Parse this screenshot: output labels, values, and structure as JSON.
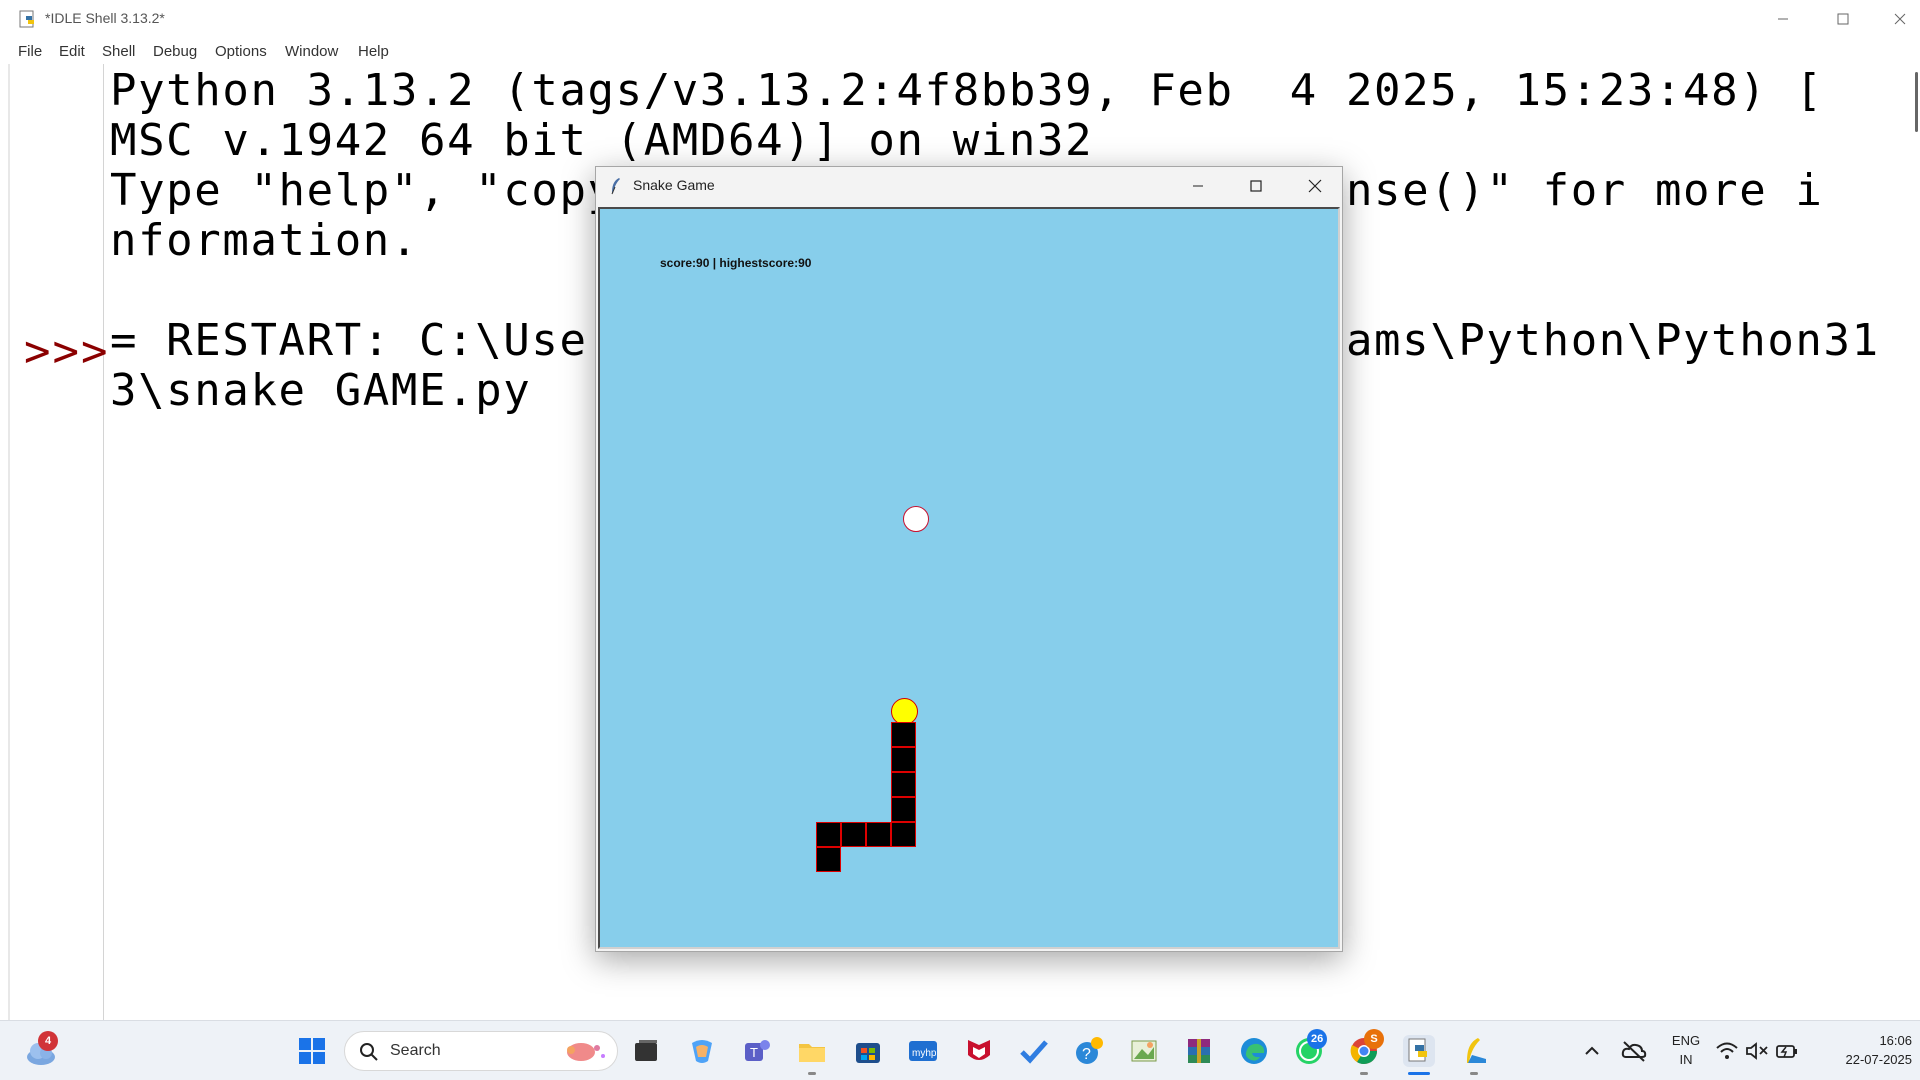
{
  "idle": {
    "title": "*IDLE Shell 3.13.2*",
    "menu": [
      "File",
      "Edit",
      "Shell",
      "Debug",
      "Options",
      "Window",
      "Help"
    ],
    "prompt": ">>>",
    "lines": [
      "Python 3.13.2 (tags/v3.13.2:4f8bb39, Feb  4 2025, 15:23:48) [",
      "MSC v.1942 64 bit (AMD64)] on win32",
      "Type \"help\", \"copyright\", \"credits\" or \"license()\" for more i",
      "nformation.",
      "",
      "= RESTART: C:\\Users\\user\\AppData\\Local\\Programs\\Python\\Python31",
      "3\\snake GAME.py"
    ]
  },
  "snake_window": {
    "title": "Snake Game",
    "score_text": "score:90 | highestscore:90",
    "colors": {
      "background": "#87ceeb",
      "snake": "#000000",
      "snake_outline": "#d00000",
      "head": "#ffff00",
      "food": "#ffffff"
    }
  },
  "taskbar": {
    "search_label": "Search",
    "weather_badge": "4",
    "whatsapp_badge": "26",
    "chrome_badge": "S",
    "language_top": "ENG",
    "language_bottom": "IN",
    "time": "16:06",
    "date": "22-07-2025"
  }
}
